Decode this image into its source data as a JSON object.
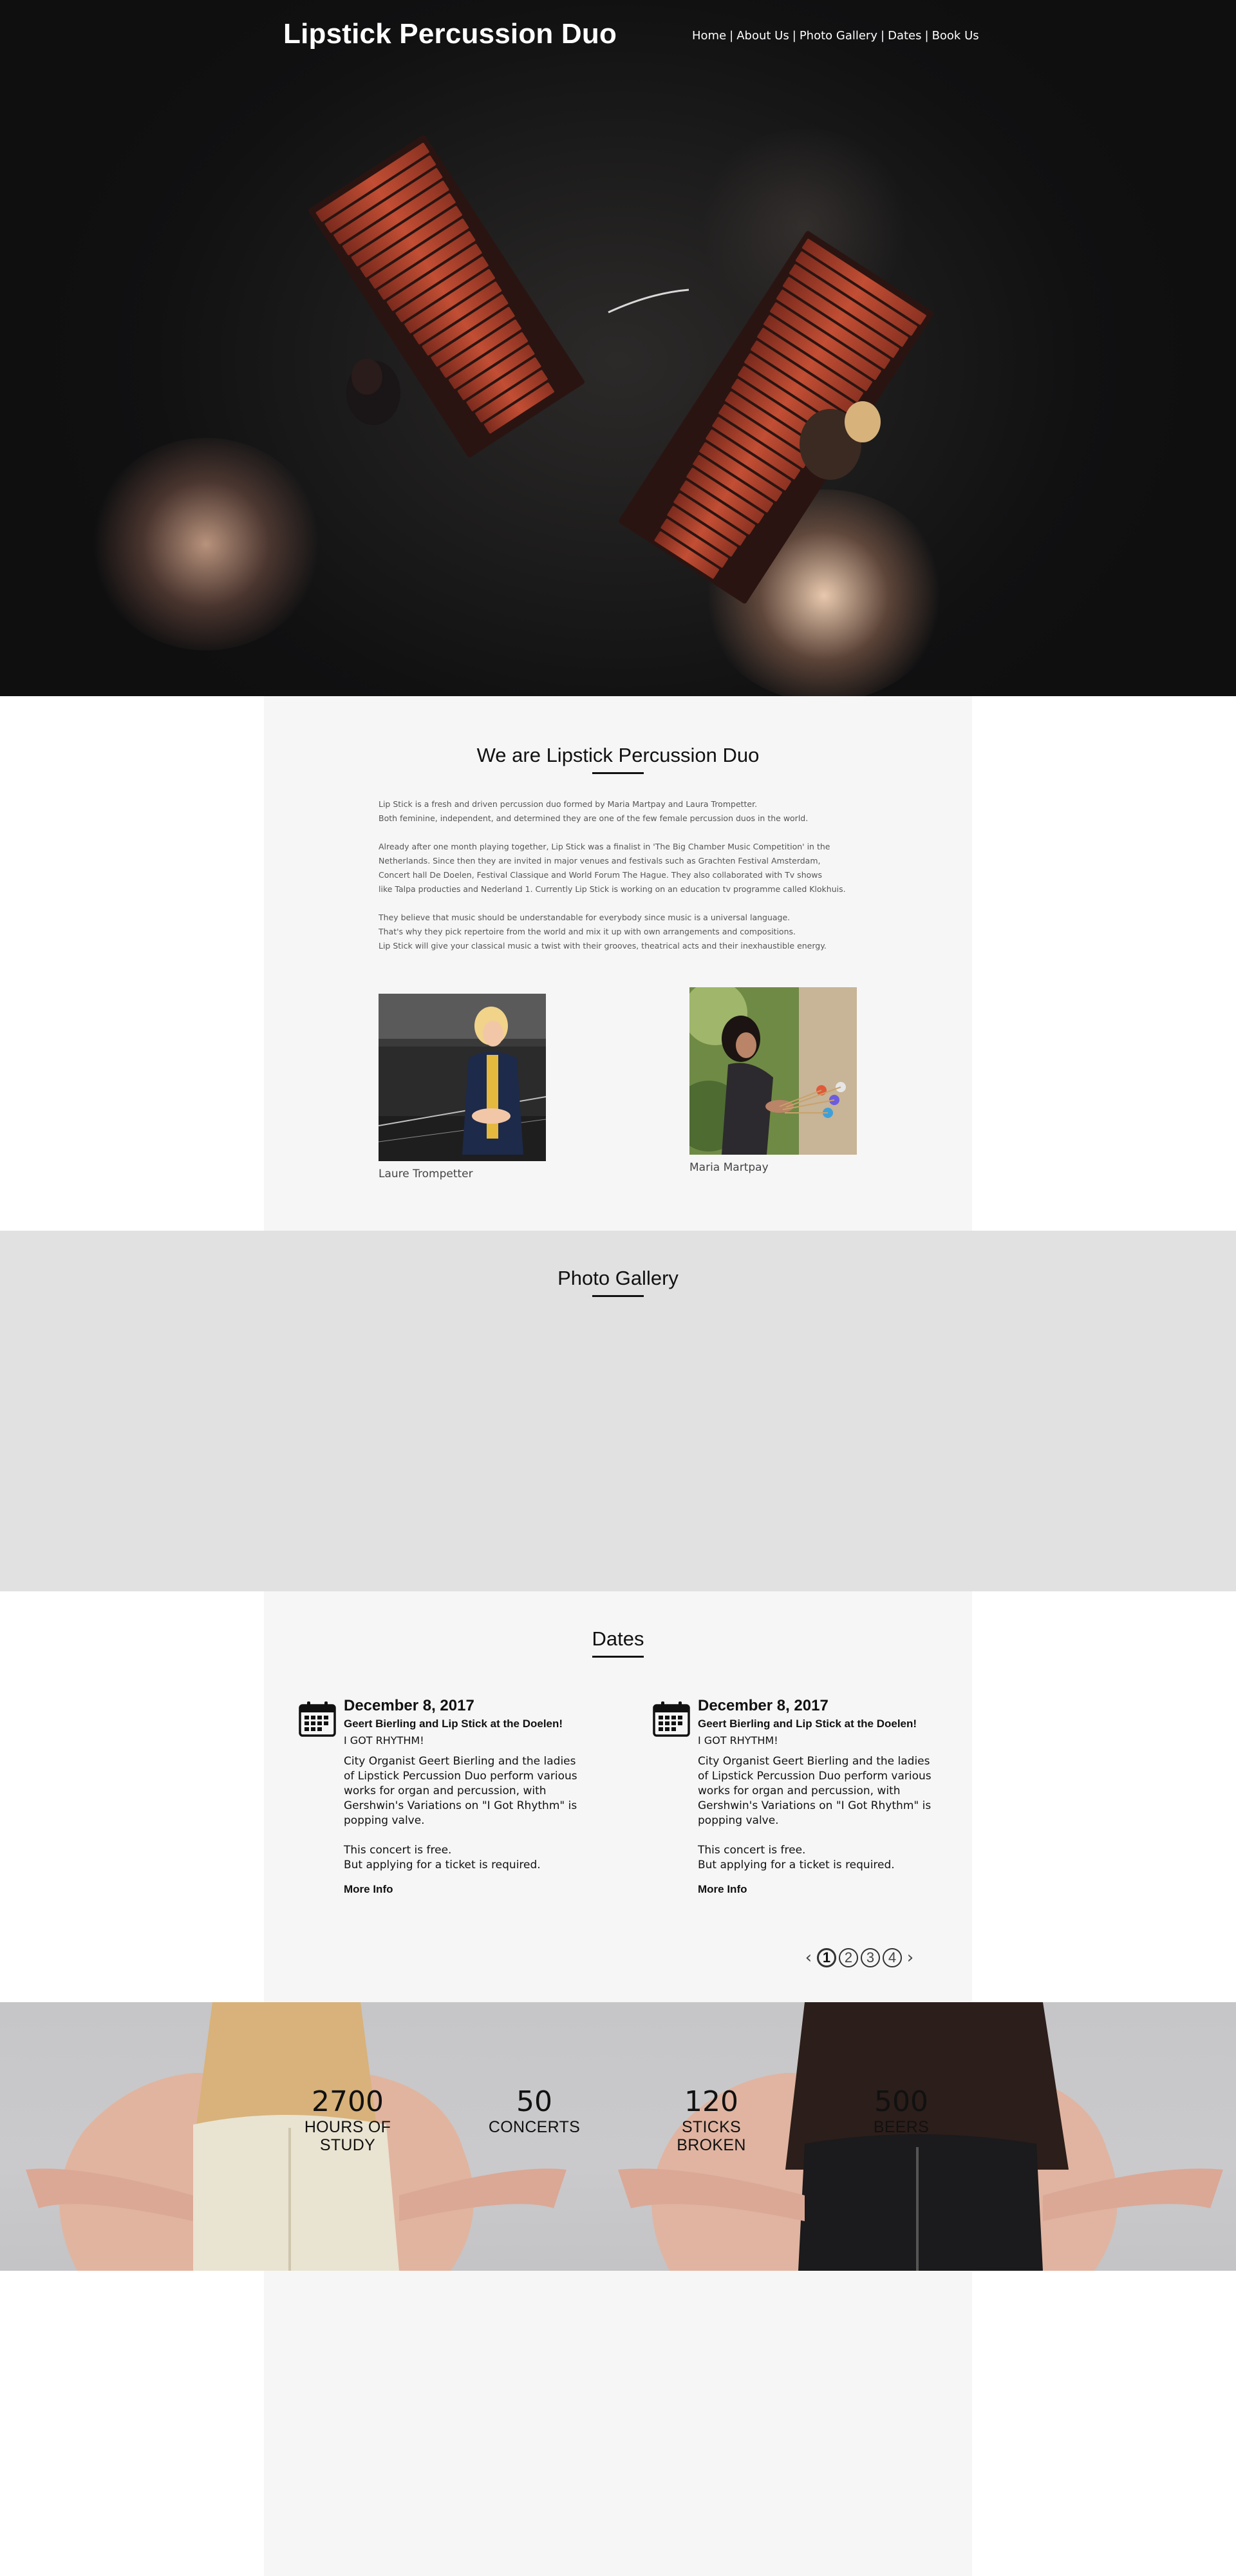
{
  "site": {
    "title": "Lipstick Percussion Duo"
  },
  "nav": {
    "items": [
      {
        "label": "Home"
      },
      {
        "label": "About Us"
      },
      {
        "label": "Photo Gallery"
      },
      {
        "label": "Dates"
      },
      {
        "label": "Book Us"
      }
    ],
    "separator": "|"
  },
  "about": {
    "title": "We are Lipstick Percussion Duo",
    "paragraphs": [
      "Lip Stick is a fresh and driven percussion duo formed by Maria Martpay and Laura Trompetter.\nBoth feminine, independent, and determined they are one of the few female percussion duos in the world.",
      "Already after one month playing together, Lip Stick was a finalist in 'The Big Chamber Music Competition' in the\nNetherlands. Since then they are invited in major venues and festivals such as Grachten Festival Amsterdam,\nConcert hall De Doelen, Festival Classique and World Forum The Hague. They also collaborated with Tv shows\nlike Talpa producties and Nederland 1. Currently Lip Stick is working on an education tv programme called Klokhuis.",
      "They believe that music should be understandable for everybody since music is a universal language.\nThat's why they pick repertoire from the world and mix it up with own arrangements and compositions.\nLip Stick will give your classical music a twist with their grooves, theatrical acts and their inexhaustible energy."
    ],
    "members": [
      {
        "name": "Laure Trompetter"
      },
      {
        "name": "Maria Martpay"
      }
    ]
  },
  "gallery": {
    "title": "Photo Gallery"
  },
  "dates": {
    "title": "Dates",
    "events": [
      {
        "date": "December 8, 2017",
        "title": "Geert Bierling and Lip Stick at the Doelen!",
        "subtitle": "I GOT RHYTHM!",
        "description": "City Organist Geert Bierling and the ladies\nof Lipstick Percussion Duo perform various\nworks for organ and percussion, with\nGershwin's Variations on \"I Got Rhythm\" is\npopping valve.\n\nThis concert is free.\nBut applying for a ticket is required.",
        "more": "More Info"
      },
      {
        "date": "December 8, 2017",
        "title": "Geert Bierling and Lip Stick at the Doelen!",
        "subtitle": "I GOT RHYTHM!",
        "description": "City Organist Geert Bierling and the ladies\nof Lipstick Percussion Duo perform various\nworks for organ and percussion, with\nGershwin's Variations on \"I Got Rhythm\" is\npopping valve.\n\nThis concert is free.\nBut applying for a ticket is required.",
        "more": "More Info"
      }
    ],
    "pagination": {
      "prev": "‹",
      "next": "›",
      "pages": [
        "1",
        "2",
        "3",
        "4"
      ],
      "current": "1"
    }
  },
  "stats": [
    {
      "value": "2700",
      "label": "HOURS OF STUDY"
    },
    {
      "value": "50",
      "label": "CONCERTS"
    },
    {
      "value": "120",
      "label": "STICKS BROKEN"
    },
    {
      "value": "500",
      "label": "BEERS"
    }
  ],
  "icons": {
    "calendar": "calendar-icon",
    "prev": "chevron-left-icon",
    "next": "chevron-right-icon"
  },
  "colors": {
    "hero_bg": "#111112",
    "marimba_bars": "#b4452f",
    "panel_bg": "#f6f6f6",
    "gallery_bg": "#e1e1e1",
    "stats_bg": "#c8c7c9",
    "text_dark": "#111111"
  }
}
